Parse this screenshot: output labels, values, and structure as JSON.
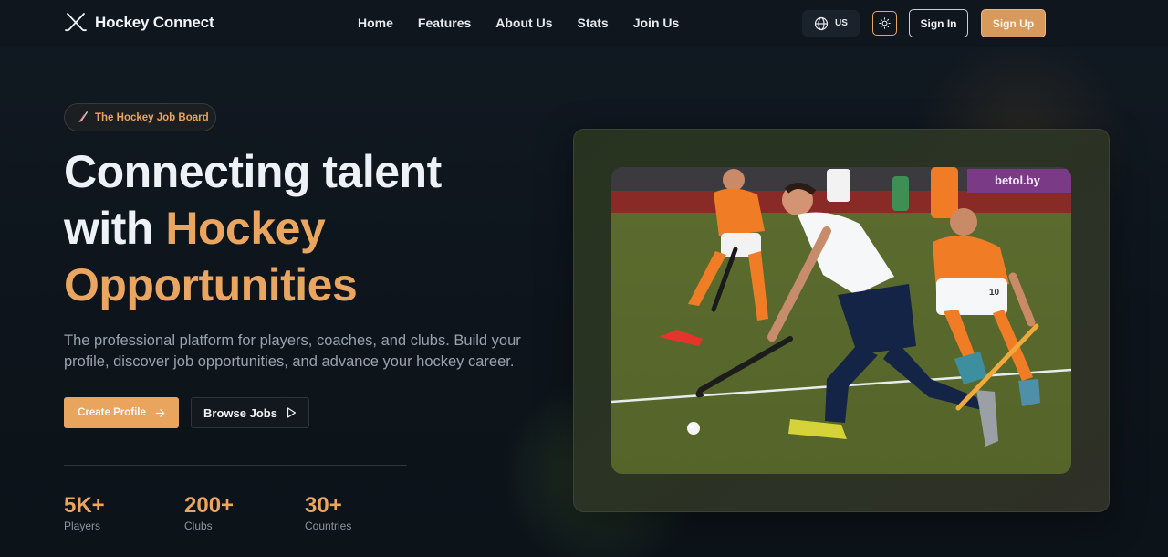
{
  "nav": {
    "brand": "Hockey Connect",
    "links": [
      "Home",
      "Features",
      "About Us",
      "Stats",
      "Join Us"
    ],
    "language": "US",
    "sign_in": "Sign In",
    "sign_up": "Sign Up"
  },
  "hero": {
    "badge": "The Hockey Job Board",
    "headline_line1": "Connecting talent",
    "headline_with": "with ",
    "headline_accent1": "Hockey",
    "headline_accent2": "Opportunities",
    "description": "The professional platform for players, coaches, and clubs. Build your profile, discover job opportunities, and advance your hockey career.",
    "primary_cta": "Create Profile",
    "secondary_cta": "Browse Jobs"
  },
  "stats": [
    {
      "value": "5K+",
      "label": "Players"
    },
    {
      "value": "200+",
      "label": "Clubs"
    },
    {
      "value": "30+",
      "label": "Countries"
    }
  ],
  "colors": {
    "accent": "#eaa560",
    "background": "#0d141b",
    "text_muted": "#98a2ad"
  },
  "icons": {
    "logo": "crossed-hockey-sticks-icon",
    "language": "globe-icon",
    "theme": "sun-icon",
    "badge": "hockey-stick-icon",
    "primary_cta": "arrow-right-icon",
    "secondary_cta": "play-icon"
  },
  "image": {
    "banner_text": "betol.by"
  }
}
